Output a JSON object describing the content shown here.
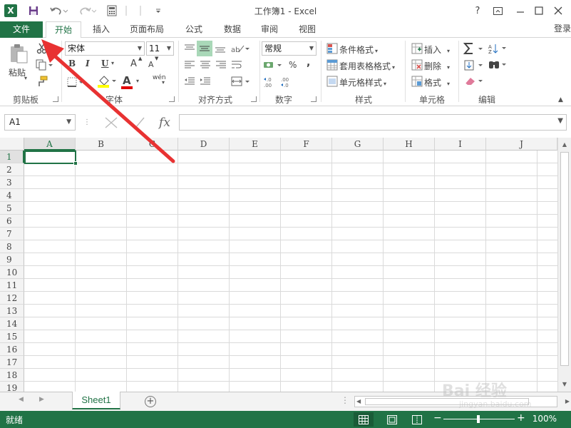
{
  "titlebar": {
    "app_icon": "X",
    "title": "工作簿1 - Excel",
    "help": "?",
    "icons": [
      "excel-logo-icon",
      "save-icon",
      "undo-icon",
      "redo-icon",
      "calculator-icon",
      "customize-qat-icon",
      "help-icon",
      "ribbon-display-icon",
      "minimize-icon",
      "maximize-icon",
      "close-icon"
    ]
  },
  "tabs": {
    "file": "文件",
    "items": [
      "开始",
      "插入",
      "页面布局",
      "公式",
      "数据",
      "审阅",
      "视图"
    ],
    "active": "开始",
    "login": "登录"
  },
  "ribbon": {
    "clipboard": {
      "paste": "粘贴",
      "label": "剪贴板"
    },
    "font": {
      "name": "宋体",
      "size": "11",
      "bold": "B",
      "italic": "I",
      "underline": "U",
      "grow": "A",
      "shrink": "A",
      "font_color": "A",
      "phonetic": "wén",
      "label": "字体"
    },
    "alignment": {
      "label": "对齐方式"
    },
    "number": {
      "format": "常规",
      "percent": "%",
      "comma": ",",
      "label": "数字"
    },
    "styles": {
      "conditional": "条件格式",
      "table": "套用表格格式",
      "cell_styles": "单元格样式",
      "label": "样式"
    },
    "cells": {
      "insert": "插入",
      "delete": "删除",
      "format": "格式",
      "label": "单元格"
    },
    "editing": {
      "label": "编辑"
    }
  },
  "formula_bar": {
    "name_box": "A1",
    "fx": "fx",
    "value": ""
  },
  "grid": {
    "columns": [
      "A",
      "B",
      "C",
      "D",
      "E",
      "F",
      "G",
      "H",
      "I",
      "J"
    ],
    "rows": [
      "1",
      "2",
      "3",
      "4",
      "5",
      "6",
      "7",
      "8",
      "9",
      "10",
      "11",
      "12",
      "13",
      "14",
      "15",
      "16",
      "17",
      "18",
      "19"
    ],
    "active_cell": "A1"
  },
  "sheets": {
    "tabs": [
      "Sheet1"
    ],
    "active": "Sheet1",
    "add": "+"
  },
  "status": {
    "ready": "就绪",
    "zoom": "100%",
    "minus": "−",
    "plus": "+"
  },
  "watermark": {
    "main": "Bai 经验",
    "sub": "jingyan.baidu.com"
  },
  "colors": {
    "excel_green": "#217346",
    "annotation_red": "#e83232"
  }
}
